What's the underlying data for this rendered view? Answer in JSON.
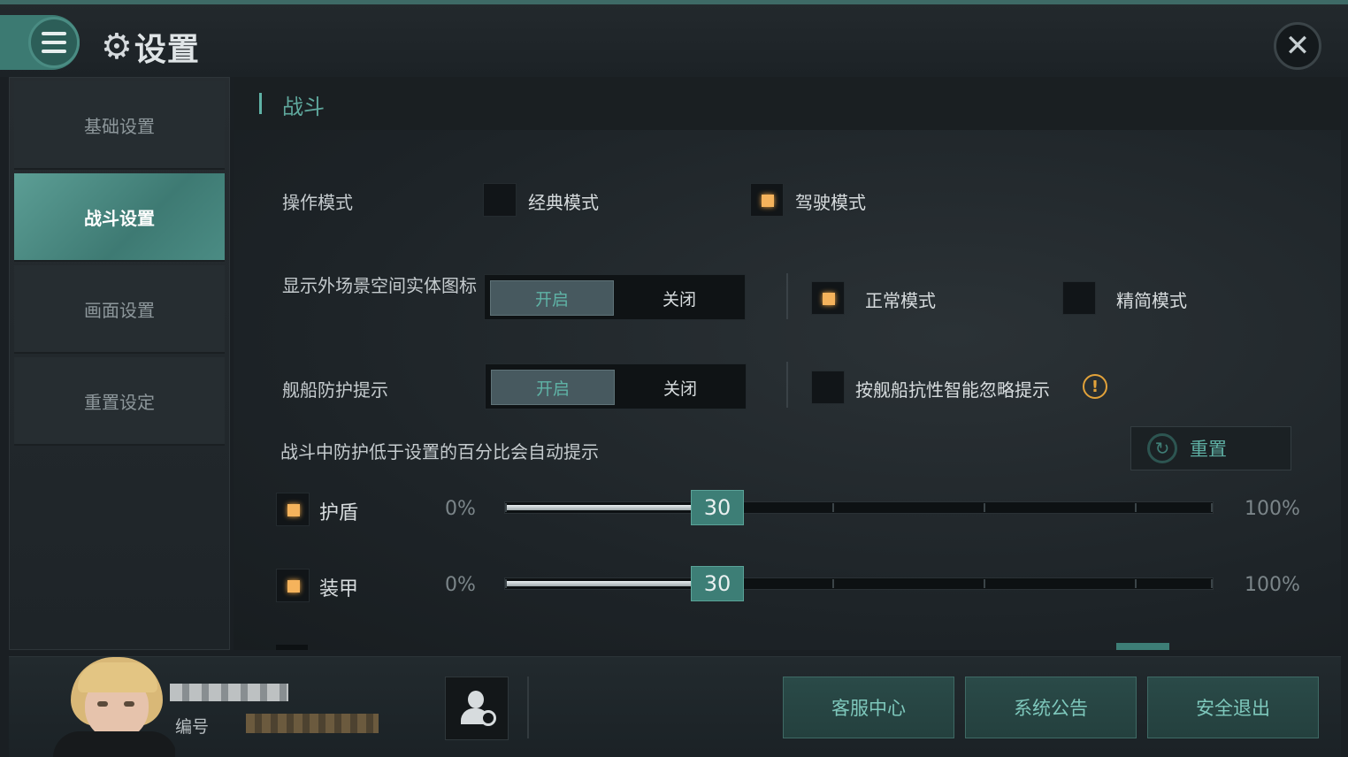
{
  "header": {
    "title": "设置",
    "menu_icon": "hamburger-icon",
    "gear_icon": "gear-icon",
    "close_icon": "close-icon"
  },
  "sidebar": {
    "items": [
      {
        "label": "基础设置",
        "active": false
      },
      {
        "label": "战斗设置",
        "active": true
      },
      {
        "label": "画面设置",
        "active": false
      },
      {
        "label": "重置设定",
        "active": false
      }
    ]
  },
  "main": {
    "section_title": "战斗",
    "operation_mode": {
      "label": "操作模式",
      "options": [
        {
          "label": "经典模式",
          "checked": false
        },
        {
          "label": "驾驶模式",
          "checked": true
        }
      ]
    },
    "show_entity_icons": {
      "label": "显示外场景空间实体图标",
      "toggle_on": "开启",
      "toggle_off": "关闭",
      "selected": "开启",
      "modes": [
        {
          "label": "正常模式",
          "checked": true
        },
        {
          "label": "精简模式",
          "checked": false
        }
      ]
    },
    "ship_protection": {
      "label": "舰船防护提示",
      "toggle_on": "开启",
      "toggle_off": "关闭",
      "selected": "开启",
      "smart_ignore": {
        "label": "按舰船抗性智能忽略提示",
        "checked": false
      },
      "info_icon": "exclamation-icon"
    },
    "auto_prompt_text": "战斗中防护低于设置的百分比会自动提示",
    "reset_label": "重置",
    "sliders": [
      {
        "label": "护盾",
        "checked": true,
        "min_label": "0%",
        "max_label": "100%",
        "value": "30",
        "percent": 30
      },
      {
        "label": "装甲",
        "checked": true,
        "min_label": "0%",
        "max_label": "100%",
        "value": "30",
        "percent": 30
      }
    ]
  },
  "footer": {
    "id_label": "编号",
    "buttons": [
      "客服中心",
      "系统公告",
      "安全退出"
    ]
  },
  "colors": {
    "accent": "#3d7e76",
    "accent_text": "#5fb0a4",
    "check_on": "#f5b35c"
  }
}
